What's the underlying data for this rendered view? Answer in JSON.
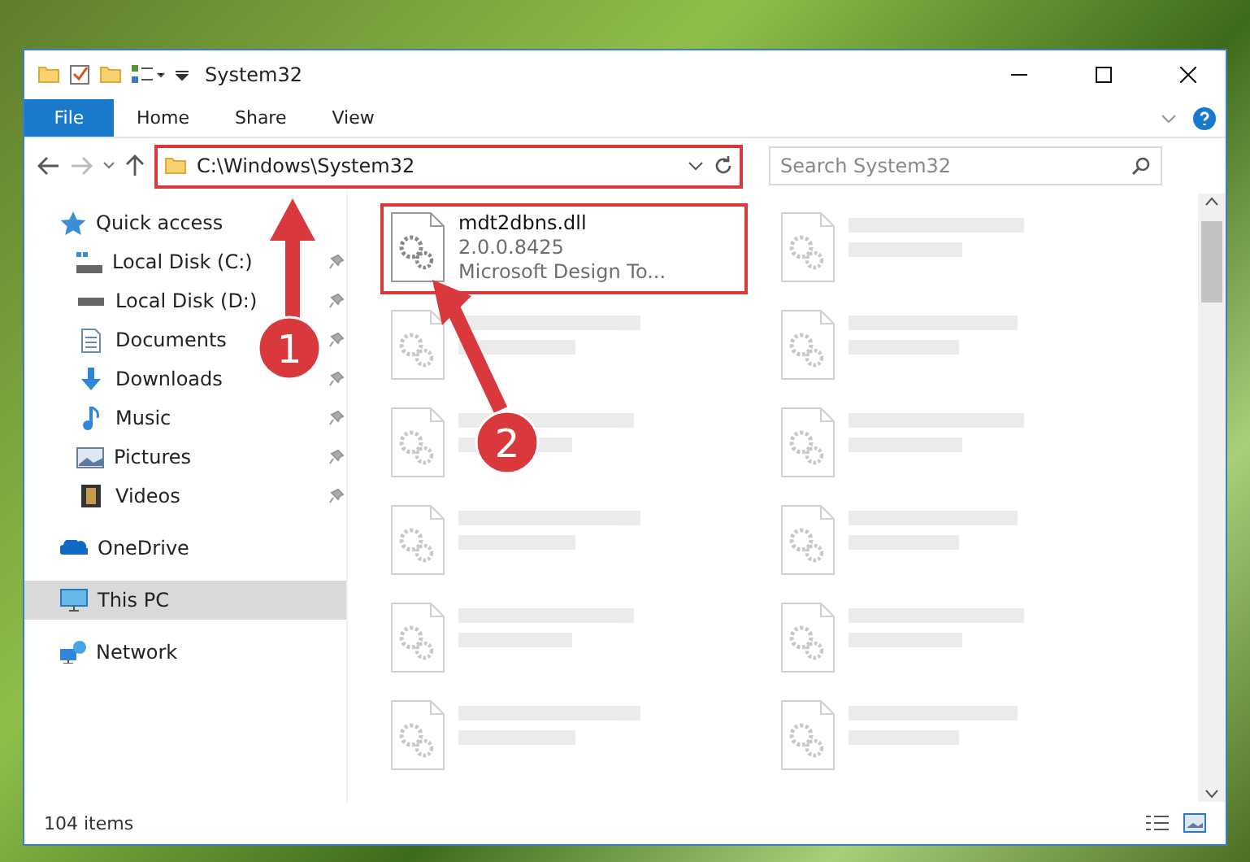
{
  "window": {
    "title": "System32"
  },
  "ribbon_tabs": [
    {
      "label": "File",
      "selected": true
    },
    {
      "label": "Home",
      "selected": false
    },
    {
      "label": "Share",
      "selected": false
    },
    {
      "label": "View",
      "selected": false
    }
  ],
  "address": {
    "path": "C:\\Windows\\System32",
    "highlighted": true
  },
  "search": {
    "placeholder": "Search System32"
  },
  "nav": [
    {
      "label": "Quick access",
      "kind": "star",
      "selected": false,
      "children": [
        {
          "label": "Local Disk (C:)",
          "kind": "system",
          "pinned": true,
          "selected": false
        },
        {
          "label": "Local Disk (D:)",
          "kind": "drive",
          "pinned": true,
          "selected": false
        },
        {
          "label": "Documents",
          "kind": "documents",
          "pinned": true,
          "selected": false
        },
        {
          "label": "Downloads",
          "kind": "downloads",
          "pinned": true,
          "selected": false
        },
        {
          "label": "Music",
          "kind": "music",
          "pinned": true,
          "selected": false
        },
        {
          "label": "Pictures",
          "kind": "pictures",
          "pinned": true,
          "selected": false
        },
        {
          "label": "Videos",
          "kind": "videos",
          "pinned": true,
          "selected": false
        }
      ]
    },
    {
      "label": "OneDrive",
      "kind": "cloud",
      "selected": false
    },
    {
      "label": "This PC",
      "kind": "pc",
      "selected": true
    },
    {
      "label": "Network",
      "kind": "network",
      "selected": false
    }
  ],
  "files": [
    {
      "name": "mdt2dbns.dll",
      "lines": [
        "2.0.0.8425",
        "Microsoft Design To..."
      ],
      "highlighted": true,
      "blurred": false
    },
    {
      "blurred": true
    },
    {
      "blurred": true
    },
    {
      "blurred": true
    },
    {
      "blurred": true
    },
    {
      "blurred": true
    },
    {
      "blurred": true
    },
    {
      "blurred": true
    },
    {
      "blurred": true
    },
    {
      "blurred": true
    },
    {
      "blurred": true
    },
    {
      "blurred": true
    }
  ],
  "status_bar": {
    "count": "104 items"
  },
  "callouts": [
    {
      "number": "1"
    },
    {
      "number": "2"
    }
  ]
}
